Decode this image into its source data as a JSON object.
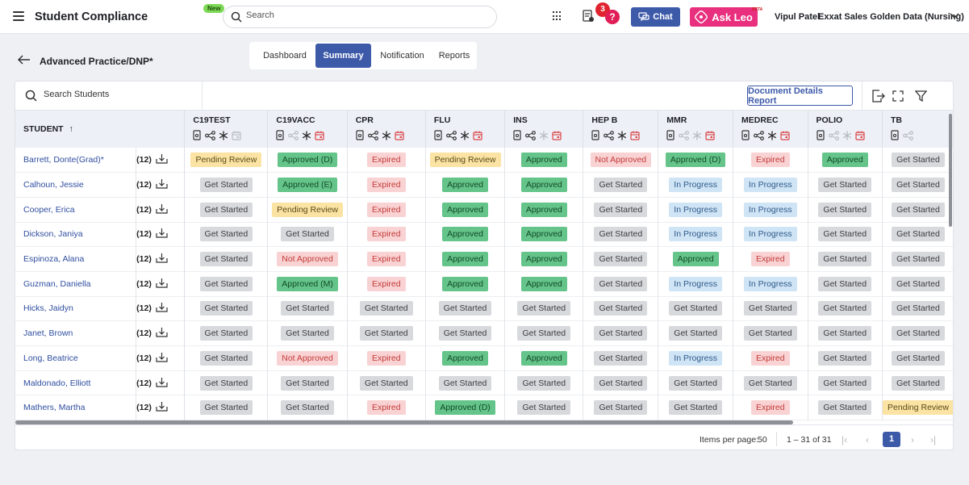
{
  "app": {
    "title": "Student Compliance",
    "new_badge": "New",
    "search_placeholder": "Search",
    "notification_count": "3",
    "help_symbol": "?",
    "chat_label": "Chat",
    "askleo_label": "Ask Leo",
    "beta_label": "BETA",
    "user_name": "Vipul Patel",
    "org_name": "Exxat Sales Golden Data (Nursing)"
  },
  "page": {
    "breadcrumb": "Advanced Practice/DNP*",
    "tabs": [
      {
        "label": "Dashboard",
        "active": false
      },
      {
        "label": "Summary",
        "active": true
      },
      {
        "label": "Notification",
        "active": false
      },
      {
        "label": "Reports",
        "active": false
      }
    ]
  },
  "toolbar": {
    "student_search_placeholder": "Search Students",
    "document_details_report": "Document Details Report"
  },
  "table": {
    "student_header": "STUDENT",
    "columns": [
      {
        "name": "C19TEST",
        "icons": [
          "doc",
          "share",
          "asterisk",
          "calendar"
        ],
        "muted": [
          false,
          false,
          false,
          true
        ]
      },
      {
        "name": "C19VACC",
        "icons": [
          "doc",
          "share",
          "asterisk",
          "calendar"
        ],
        "muted": [
          false,
          true,
          false,
          false
        ]
      },
      {
        "name": "CPR",
        "icons": [
          "doc",
          "share",
          "asterisk",
          "calendar"
        ],
        "muted": [
          false,
          false,
          false,
          false
        ]
      },
      {
        "name": "FLU",
        "icons": [
          "doc",
          "share",
          "asterisk",
          "calendar"
        ],
        "muted": [
          false,
          false,
          false,
          false
        ]
      },
      {
        "name": "INS",
        "icons": [
          "doc",
          "share",
          "asterisk",
          "calendar"
        ],
        "muted": [
          false,
          false,
          true,
          false
        ]
      },
      {
        "name": "HEP B",
        "icons": [
          "doc",
          "share",
          "asterisk",
          "calendar"
        ],
        "muted": [
          false,
          false,
          false,
          false
        ]
      },
      {
        "name": "MMR",
        "icons": [
          "doc",
          "share",
          "asterisk",
          "calendar"
        ],
        "muted": [
          false,
          true,
          true,
          false
        ]
      },
      {
        "name": "MEDREC",
        "icons": [
          "doc",
          "share",
          "asterisk",
          "calendar"
        ],
        "muted": [
          false,
          false,
          false,
          false
        ]
      },
      {
        "name": "POLIO",
        "icons": [
          "doc",
          "share",
          "asterisk",
          "calendar"
        ],
        "muted": [
          false,
          true,
          true,
          false
        ]
      },
      {
        "name": "TB",
        "icons": [
          "doc",
          "share"
        ],
        "muted": [
          false,
          true
        ]
      }
    ],
    "rows": [
      {
        "name": "Barrett, Donte(Grad)*",
        "count": "(12)",
        "statuses": [
          "Pending Review",
          "Approved (D)",
          "Expired",
          "Pending Review",
          "Approved",
          "Not Approved",
          "Approved (D)",
          "Expired",
          "Approved",
          "Get Started"
        ]
      },
      {
        "name": "Calhoun, Jessie",
        "count": "(12)",
        "statuses": [
          "Get Started",
          "Approved (E)",
          "Expired",
          "Approved",
          "Approved",
          "Get Started",
          "In Progress",
          "In Progress",
          "Get Started",
          "Get Started"
        ]
      },
      {
        "name": "Cooper, Erica",
        "count": "(12)",
        "statuses": [
          "Get Started",
          "Pending Review",
          "Expired",
          "Approved",
          "Approved",
          "Get Started",
          "In Progress",
          "In Progress",
          "Get Started",
          "Get Started"
        ]
      },
      {
        "name": "Dickson, Janiya",
        "count": "(12)",
        "statuses": [
          "Get Started",
          "Get Started",
          "Expired",
          "Approved",
          "Approved",
          "Get Started",
          "In Progress",
          "In Progress",
          "Get Started",
          "Get Started"
        ]
      },
      {
        "name": "Espinoza, Alana",
        "count": "(12)",
        "statuses": [
          "Get Started",
          "Not Approved",
          "Expired",
          "Approved",
          "Approved",
          "Get Started",
          "Approved",
          "Expired",
          "Get Started",
          "Get Started"
        ]
      },
      {
        "name": "Guzman, Daniella",
        "count": "(12)",
        "statuses": [
          "Get Started",
          "Approved (M)",
          "Expired",
          "Approved",
          "Approved",
          "Get Started",
          "In Progress",
          "In Progress",
          "Get Started",
          "Get Started"
        ]
      },
      {
        "name": "Hicks, Jaidyn",
        "count": "(12)",
        "statuses": [
          "Get Started",
          "Get Started",
          "Get Started",
          "Get Started",
          "Get Started",
          "Get Started",
          "Get Started",
          "Get Started",
          "Get Started",
          "Get Started"
        ]
      },
      {
        "name": "Janet, Brown",
        "count": "(12)",
        "statuses": [
          "Get Started",
          "Get Started",
          "Get Started",
          "Get Started",
          "Get Started",
          "Get Started",
          "Get Started",
          "Get Started",
          "Get Started",
          "Get Started"
        ]
      },
      {
        "name": "Long, Beatrice",
        "count": "(12)",
        "statuses": [
          "Get Started",
          "Not Approved",
          "Expired",
          "Approved",
          "Approved",
          "Get Started",
          "In Progress",
          "Expired",
          "Get Started",
          "Get Started"
        ]
      },
      {
        "name": "Maldonado, Elliott",
        "count": "(12)",
        "statuses": [
          "Get Started",
          "Get Started",
          "Get Started",
          "Get Started",
          "Get Started",
          "Get Started",
          "Get Started",
          "Get Started",
          "Get Started",
          "Get Started"
        ]
      },
      {
        "name": "Mathers, Martha",
        "count": "(12)",
        "statuses": [
          "Get Started",
          "Get Started",
          "Expired",
          "Approved (D)",
          "Get Started",
          "Get Started",
          "Get Started",
          "Expired",
          "Get Started",
          "Pending Review"
        ]
      }
    ]
  },
  "pagination": {
    "items_per_page_label": "Items per page:",
    "items_per_page_value": "50",
    "range": "1 – 31 of 31",
    "current_page": "1"
  },
  "colors": {
    "primary": "#3d5aa9",
    "askleo": "#e8307e",
    "approved": "#65c48a",
    "pending": "#fbe3a3",
    "expired": "#f9d3d3",
    "get_started": "#d7d9dd",
    "in_progress": "#cfe4f5"
  }
}
